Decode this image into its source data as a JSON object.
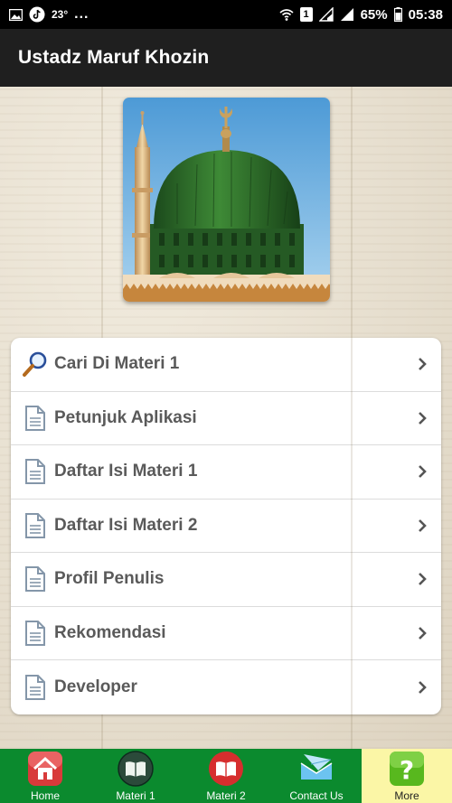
{
  "status_bar": {
    "temperature": "23°",
    "more": "...",
    "sim": "1",
    "battery": "65%",
    "time": "05:38"
  },
  "app_bar": {
    "title": "Ustadz Maruf Khozin"
  },
  "menu": {
    "items": [
      {
        "label": "Cari Di Materi 1",
        "icon": "search-icon"
      },
      {
        "label": "Petunjuk Aplikasi",
        "icon": "document-icon"
      },
      {
        "label": "Daftar Isi Materi 1",
        "icon": "document-icon"
      },
      {
        "label": "Daftar Isi Materi 2",
        "icon": "document-icon"
      },
      {
        "label": "Profil Penulis",
        "icon": "document-icon"
      },
      {
        "label": "Rekomendasi",
        "icon": "document-icon"
      },
      {
        "label": "Developer",
        "icon": "document-icon"
      }
    ]
  },
  "bottom_nav": {
    "items": [
      {
        "label": "Home",
        "icon": "home-icon"
      },
      {
        "label": "Materi 1",
        "icon": "book-icon"
      },
      {
        "label": "Materi 2",
        "icon": "book-icon"
      },
      {
        "label": "Contact Us",
        "icon": "mail-icon"
      },
      {
        "label": "More",
        "icon": "question-icon",
        "active": true
      }
    ]
  },
  "colors": {
    "app_bar": "#1f1f1f",
    "bottom_nav": "#0b8a2e",
    "active_tab": "#fbf6a6",
    "dome_green": "#2f6b2a"
  }
}
